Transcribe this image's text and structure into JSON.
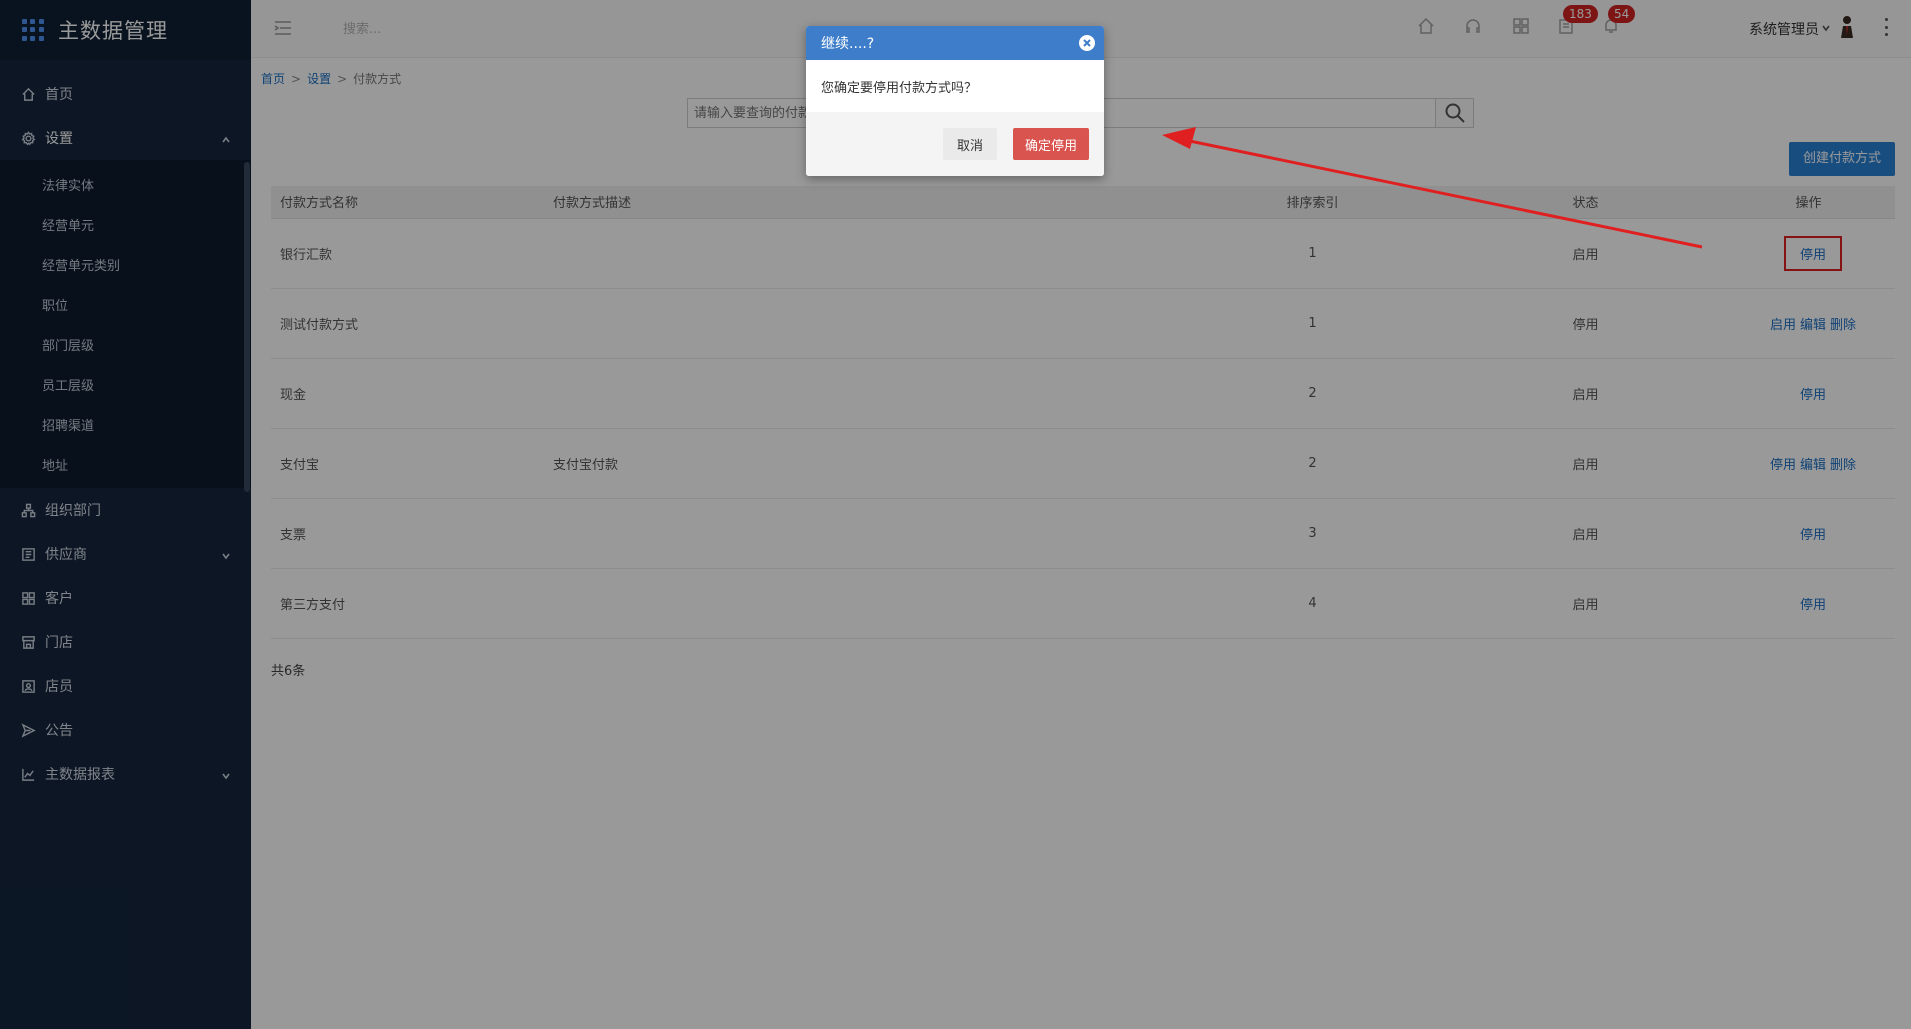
{
  "app": {
    "title": "主数据管理"
  },
  "sidebar": {
    "items": [
      {
        "label": "首页"
      },
      {
        "label": "设置"
      },
      {
        "label": "组织部门"
      },
      {
        "label": "供应商"
      },
      {
        "label": "客户"
      },
      {
        "label": "门店"
      },
      {
        "label": "店员"
      },
      {
        "label": "公告"
      },
      {
        "label": "主数据报表"
      }
    ],
    "sub_items": [
      "法律实体",
      "经营单元",
      "经营单元类别",
      "职位",
      "部门层级",
      "员工层级",
      "招聘渠道",
      "地址"
    ]
  },
  "topbar": {
    "search_placeholder": "搜索...",
    "badges": {
      "messages": "183",
      "notifications": "54"
    },
    "user": "系统管理员"
  },
  "breadcrumb": {
    "home": "首页",
    "settings": "设置",
    "current": "付款方式",
    "sep": ">"
  },
  "query": {
    "placeholder": "请输入要查询的付款方式名称"
  },
  "create_button": "创建付款方式",
  "table": {
    "headers": [
      "付款方式名称",
      "付款方式描述",
      "排序索引",
      "状态",
      "操作"
    ],
    "rows": [
      {
        "name": "银行汇款",
        "desc": "",
        "index": "1",
        "status": "启用",
        "ops": [
          "停用"
        ]
      },
      {
        "name": "测试付款方式",
        "desc": "",
        "index": "1",
        "status": "停用",
        "ops": [
          "启用",
          "编辑",
          "删除"
        ]
      },
      {
        "name": "现金",
        "desc": "",
        "index": "2",
        "status": "启用",
        "ops": [
          "停用"
        ]
      },
      {
        "name": "支付宝",
        "desc": "支付宝付款",
        "index": "2",
        "status": "启用",
        "ops": [
          "停用",
          "编辑",
          "删除"
        ]
      },
      {
        "name": "支票",
        "desc": "",
        "index": "3",
        "status": "启用",
        "ops": [
          "停用"
        ]
      },
      {
        "name": "第三方支付",
        "desc": "",
        "index": "4",
        "status": "启用",
        "ops": [
          "停用"
        ]
      }
    ],
    "total": "共6条"
  },
  "dialog": {
    "title": "继续....?",
    "message": "您确定要停用付款方式吗？",
    "cancel": "取消",
    "confirm": "确定停用"
  },
  "colors": {
    "sidebar": "#14263d",
    "accent": "#2980d6",
    "dialog_header": "#3d7dc9",
    "danger": "#d9534f",
    "annotation": "#e02020"
  }
}
